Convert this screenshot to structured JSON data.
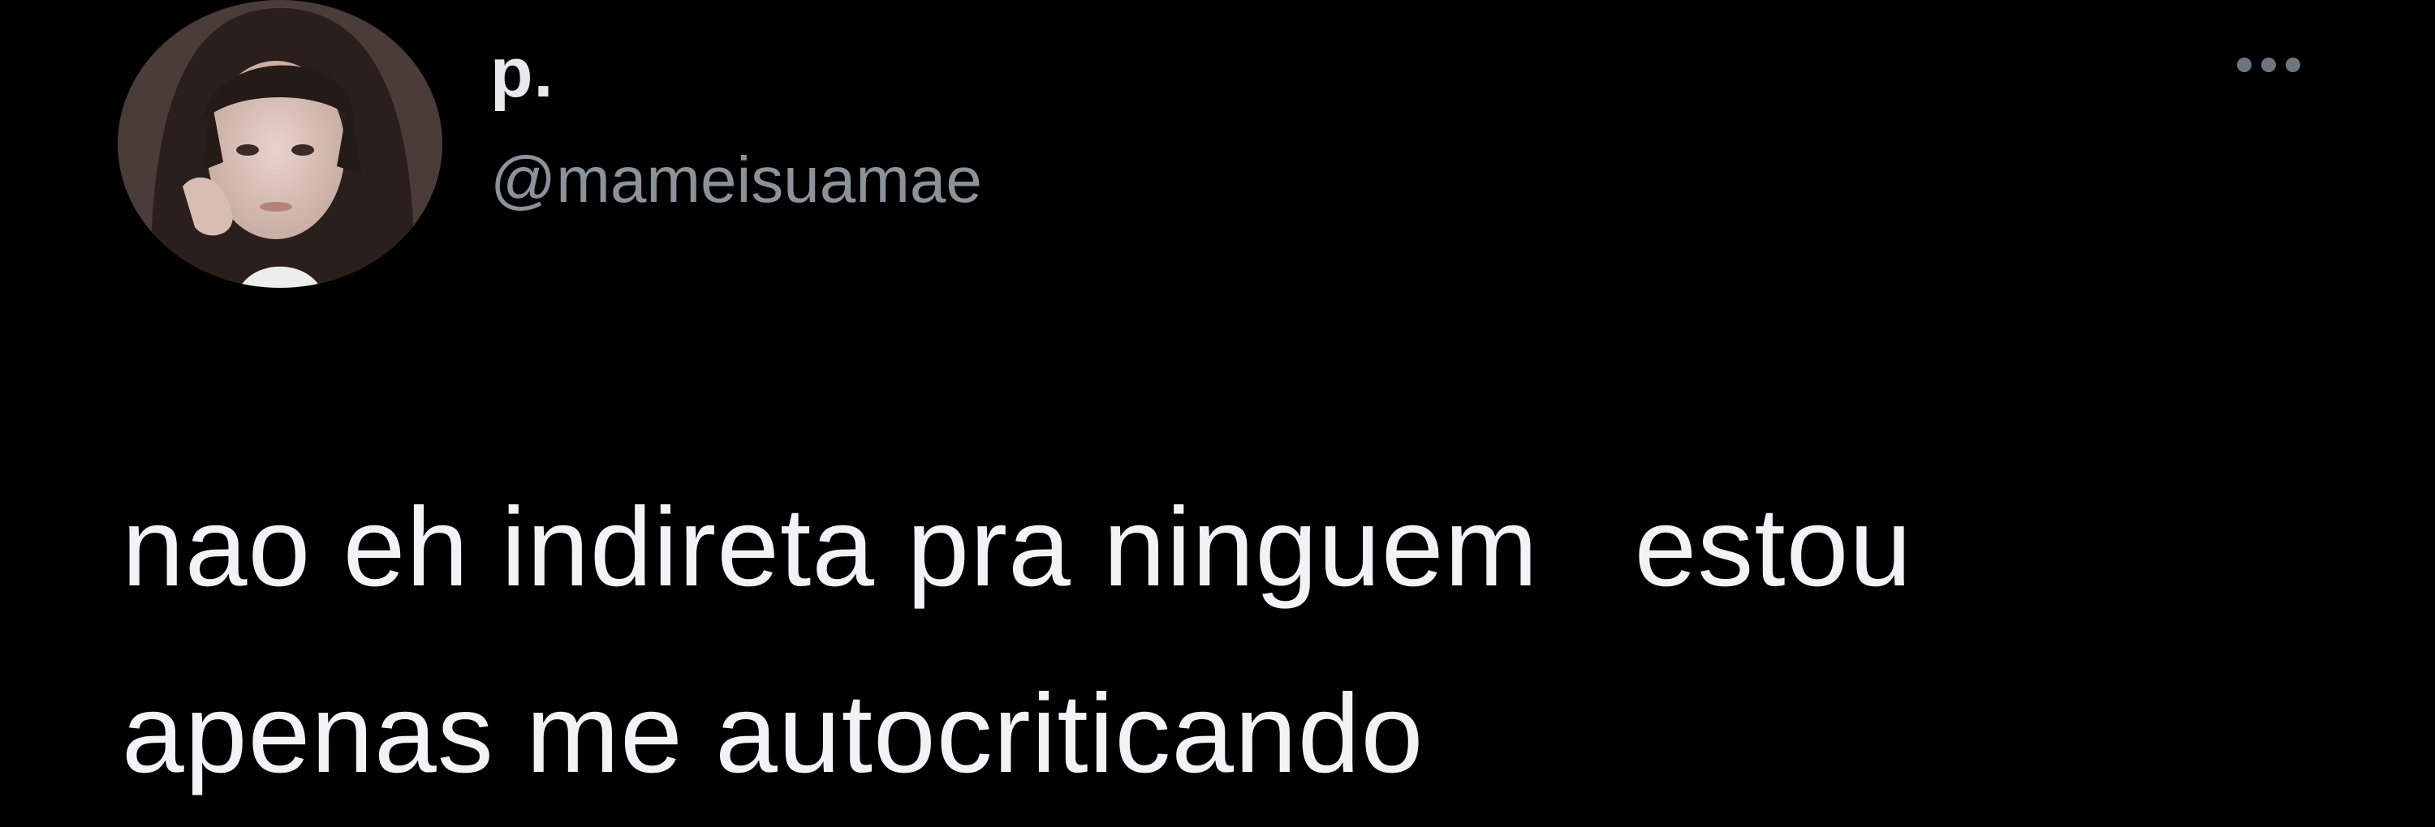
{
  "tweet": {
    "display_name": "p.",
    "handle": "@mameisuamae",
    "text_line1": "nao eh indireta pra ninguem   estou",
    "text_line2": "apenas me autocriticando"
  },
  "icons": {
    "avatar": "profile-photo",
    "more": "more-options-icon"
  },
  "colors": {
    "background": "#000000",
    "primary_text": "#e7e9ea",
    "secondary_text": "#8b9299"
  }
}
